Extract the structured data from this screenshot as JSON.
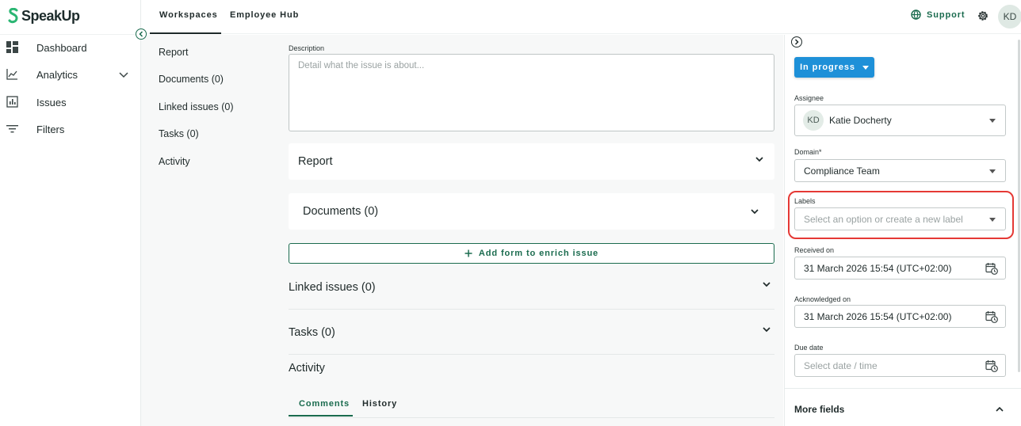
{
  "brand": {
    "name": "SpeakUp",
    "accent": "#1a6b4e",
    "status_blue": "#1e90d8",
    "highlight": "#e53935"
  },
  "sidebar": {
    "items": [
      {
        "label": "Dashboard",
        "icon": "dashboard-icon"
      },
      {
        "label": "Analytics",
        "icon": "analytics-icon"
      },
      {
        "label": "Issues",
        "icon": "issues-icon"
      },
      {
        "label": "Filters",
        "icon": "filters-icon"
      }
    ]
  },
  "topnav": {
    "tabs": [
      "Workspaces",
      "Employee Hub"
    ],
    "active_tab": "Workspaces",
    "support_label": "Support",
    "user_initials": "KD"
  },
  "section_nav": {
    "items": [
      "Report",
      "Documents (0)",
      "Linked issues (0)",
      "Tasks (0)",
      "Activity"
    ]
  },
  "main": {
    "description_label": "Description",
    "description_placeholder": "Detail what the issue is about...",
    "report_title": "Report",
    "documents_title": "Documents (0)",
    "add_form_label": "Add form to enrich issue",
    "linked_issues_title": "Linked issues (0)",
    "tasks_title": "Tasks (0)",
    "activity_title": "Activity",
    "activity_tabs": [
      "Comments",
      "History"
    ],
    "active_activity_tab": "Comments"
  },
  "details": {
    "status_label": "In progress",
    "assignee_label": "Assignee",
    "assignee_initials": "KD",
    "assignee_name": "Katie Docherty",
    "domain_label": "Domain*",
    "domain_value": "Compliance Team",
    "labels_label": "Labels",
    "labels_placeholder": "Select an option or create a new label",
    "received_label": "Received on",
    "received_value": "31 March 2026 15:54 (UTC+02:00)",
    "acknowledged_label": "Acknowledged on",
    "acknowledged_value": "31 March 2026 15:54 (UTC+02:00)",
    "due_label": "Due date",
    "due_placeholder": "Select date / time",
    "more_fields_label": "More fields"
  }
}
